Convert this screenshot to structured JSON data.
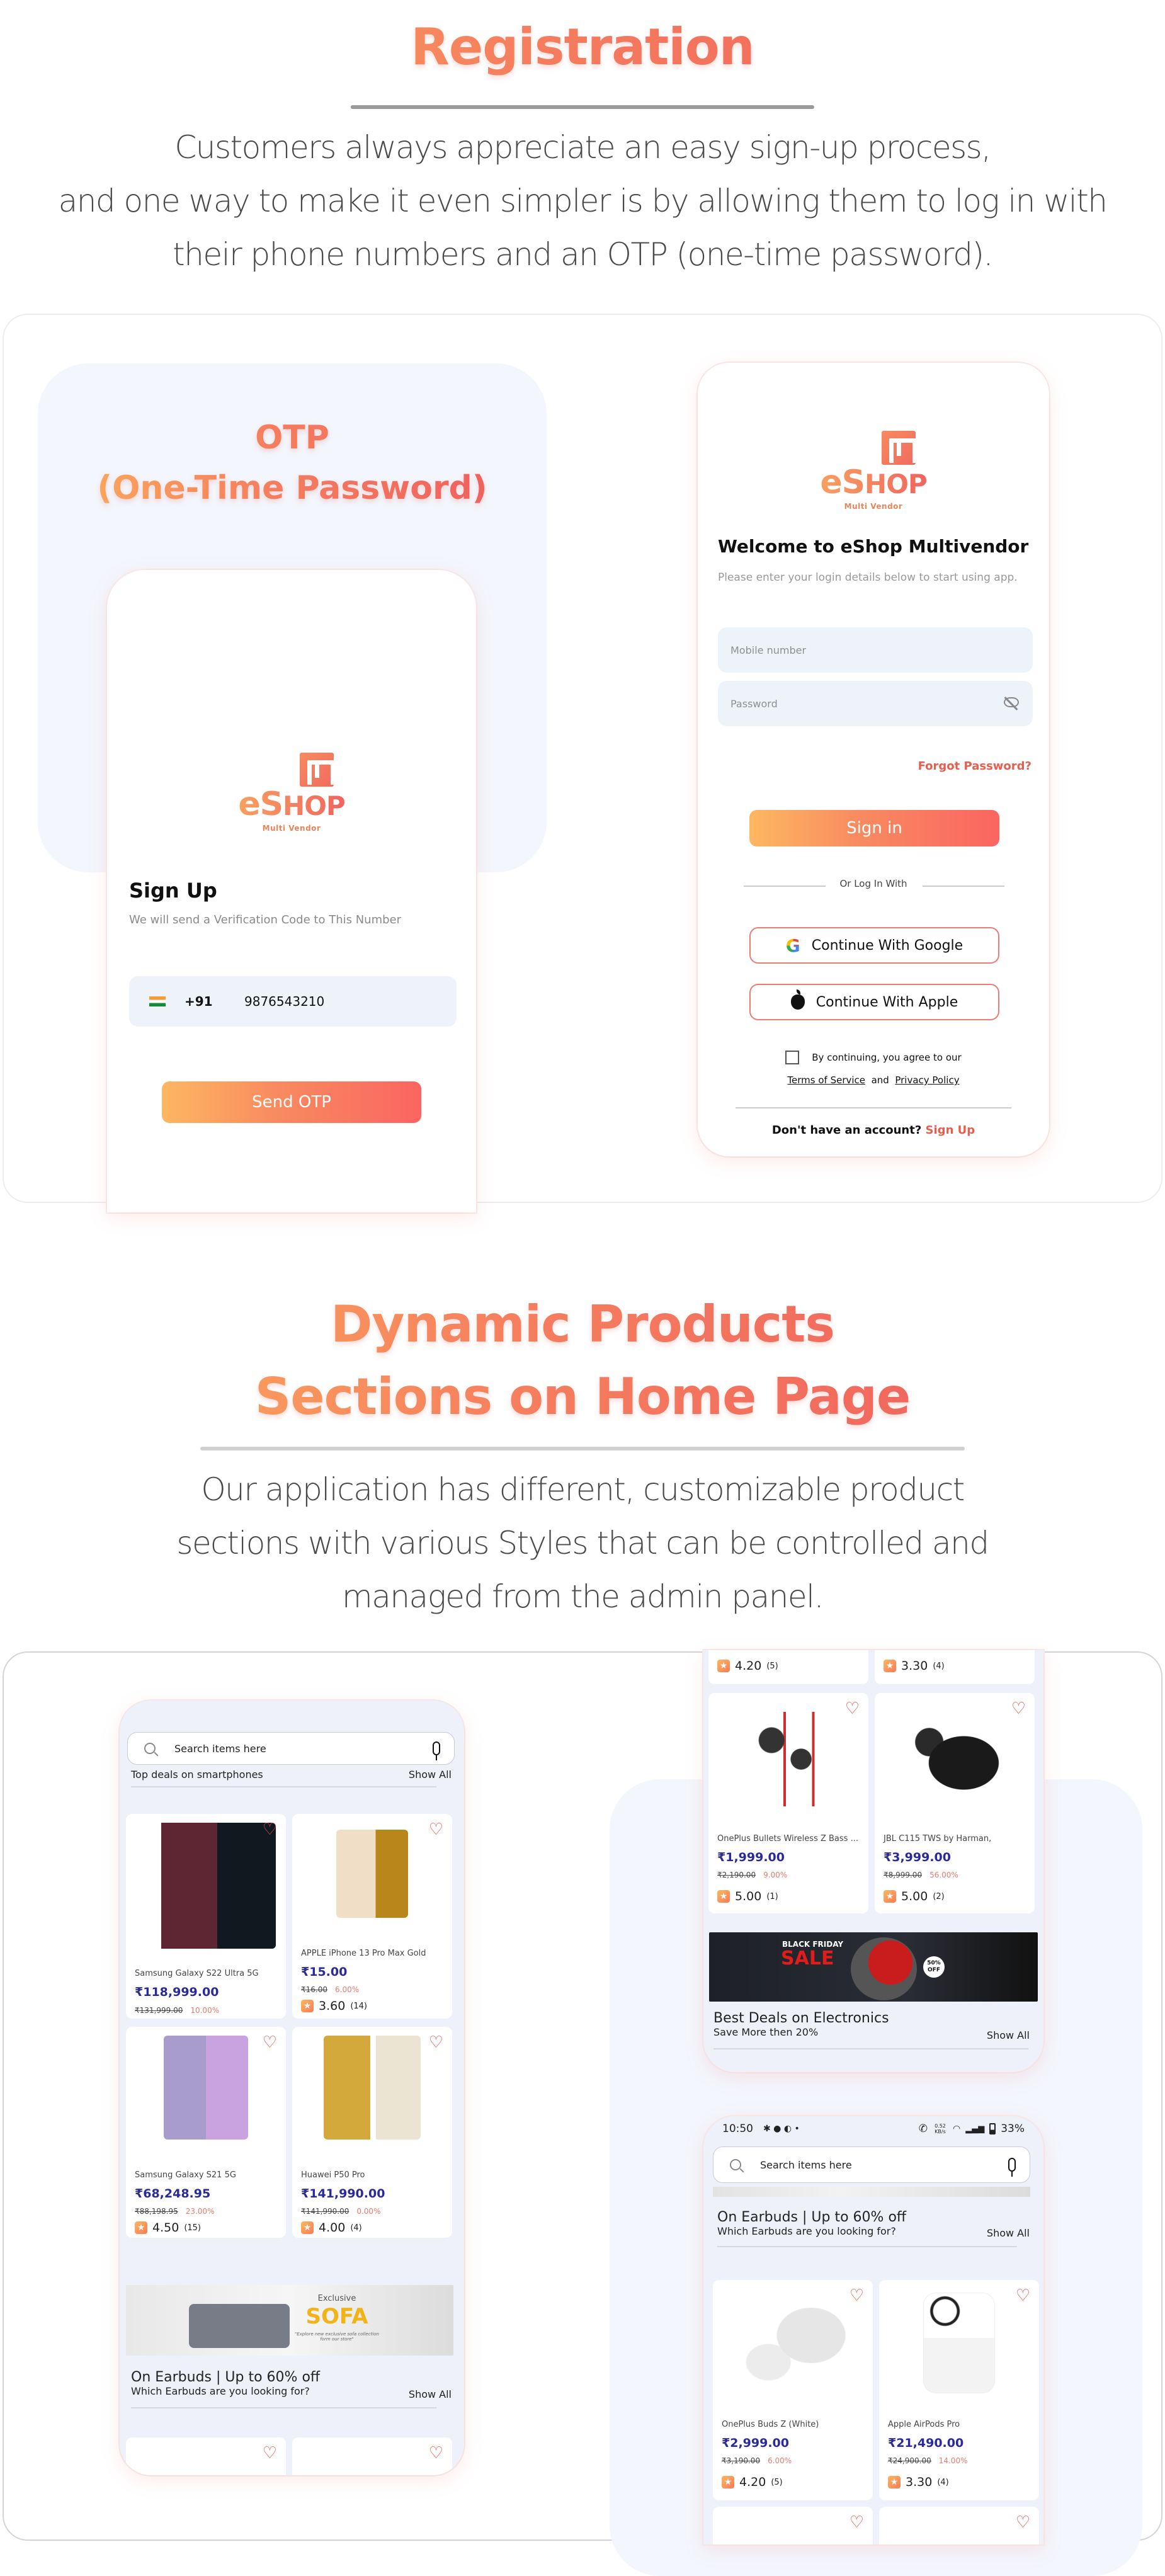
{
  "registration": {
    "title": "Registration",
    "description_lines": [
      "Customers always appreciate an easy sign-up process,",
      "and one way to make it even simpler is by allowing them to log in with",
      "their phone numbers and an OTP (one-time password)."
    ],
    "otp_heading_line1": "OTP",
    "otp_heading_line2": "(One-Time Password)"
  },
  "brand": {
    "logo_word_e": "e",
    "logo_word_s": "S",
    "logo_word_rest": "HOP",
    "logo_sub": "Multi Vendor",
    "accent_color": "#f0645f",
    "gradient_start": "#fdb761",
    "gradient_end": "#fa6561"
  },
  "signup_screen": {
    "title": "Sign Up",
    "subtitle": "We will send a Verification Code to This Number",
    "country_flag_icon": "india-flag-icon",
    "country_code": "+91",
    "phone_value": "9876543210",
    "send_otp_label": "Send OTP"
  },
  "login_screen": {
    "title": "Welcome to eShop Multivendor",
    "subtitle": "Please enter your login details below to start using app.",
    "mobile_placeholder": "Mobile number",
    "password_placeholder": "Password",
    "password_toggle_icon": "eye-off-icon",
    "forgot_password": "Forgot Password?",
    "sign_in_label": "Sign in",
    "divider_text": "Or Log In With",
    "google_label": "Continue With Google",
    "apple_label": "Continue With Apple",
    "agree_text": "By continuing, you agree to our",
    "terms_label": "Terms of Service",
    "and_text": "and",
    "privacy_label": "Privacy Policy",
    "no_account_text": "Don't have an account?",
    "sign_up_link": "Sign Up",
    "agree_checked": false
  },
  "dynamic_products": {
    "title_line1": "Dynamic Products",
    "title_line2": "Sections on Home Page",
    "description_lines": [
      "Our application has different, customizable product",
      "sections with various Styles that can be controlled and",
      "managed from the admin panel."
    ]
  },
  "phone_left": {
    "search_placeholder": "Search items here",
    "section1": {
      "title": "Top deals on smartphones",
      "show_all": "Show All"
    },
    "products": [
      {
        "name": "Samsung Galaxy S22 Ultra 5G",
        "price": "₹118,999.00",
        "old_price": "₹131,999.00",
        "discount": "10.00%",
        "rating": "",
        "reviews": ""
      },
      {
        "name": "APPLE iPhone 13 Pro Max Gold",
        "price": "₹15.00",
        "old_price": "₹16.00",
        "discount": "6.00%",
        "rating": "3.60",
        "reviews": "(14)"
      },
      {
        "name": "Samsung Galaxy S21 5G",
        "price": "₹68,248.95",
        "old_price": "₹88,198.95",
        "discount": "23.00%",
        "rating": "4.50",
        "reviews": "(15)"
      },
      {
        "name": "Huawei P50 Pro",
        "price": "₹141,990.00",
        "old_price": "₹141,990.00",
        "discount": "0.00%",
        "rating": "4.00",
        "reviews": "(4)"
      }
    ],
    "banner": {
      "small": "Exclusive",
      "big": "SOFA",
      "tagline": "\"Explore new exclusive sofa collection form our store\""
    },
    "section2": {
      "title": "On Earbuds | Up to 60% off",
      "subtitle": "Which Earbuds are you looking for?",
      "show_all": "Show All"
    }
  },
  "phone_right_top": {
    "top_ratings": [
      {
        "rating": "4.20",
        "reviews": "(5)"
      },
      {
        "rating": "3.30",
        "reviews": "(4)"
      }
    ],
    "products": [
      {
        "name": "OnePlus Bullets Wireless Z Bass ...",
        "price": "₹1,999.00",
        "old_price": "₹2,190.00",
        "discount": "9.00%",
        "rating": "5.00",
        "reviews": "(1)"
      },
      {
        "name": "JBL C115 TWS by Harman,",
        "price": "₹3,999.00",
        "old_price": "₹8,999.00",
        "discount": "56.00%",
        "rating": "5.00",
        "reviews": "(2)"
      }
    ],
    "banner": {
      "line1": "BLACK FRIDAY",
      "line2": "SALE",
      "badge_top": "50%",
      "badge_bottom": "OFF"
    },
    "section": {
      "title": "Best Deals on Electronics",
      "subtitle": "Save More then 20%",
      "show_all": "Show All"
    }
  },
  "phone_right_bottom": {
    "status_time": "10:50",
    "status_speed": "0.52 KB/s",
    "status_battery": "33%",
    "search_placeholder": "Search items here",
    "section": {
      "title": "On Earbuds | Up to 60% off",
      "subtitle": "Which Earbuds are you looking for?",
      "show_all": "Show All"
    },
    "products": [
      {
        "name": "OnePlus Buds Z (White)",
        "price": "₹2,999.00",
        "old_price": "₹3,190.00",
        "discount": "6.00%",
        "rating": "4.20",
        "reviews": "(5)"
      },
      {
        "name": "Apple AirPods Pro",
        "price": "₹21,490.00",
        "old_price": "₹24,900.00",
        "discount": "14.00%",
        "rating": "3.30",
        "reviews": "(4)"
      }
    ]
  }
}
